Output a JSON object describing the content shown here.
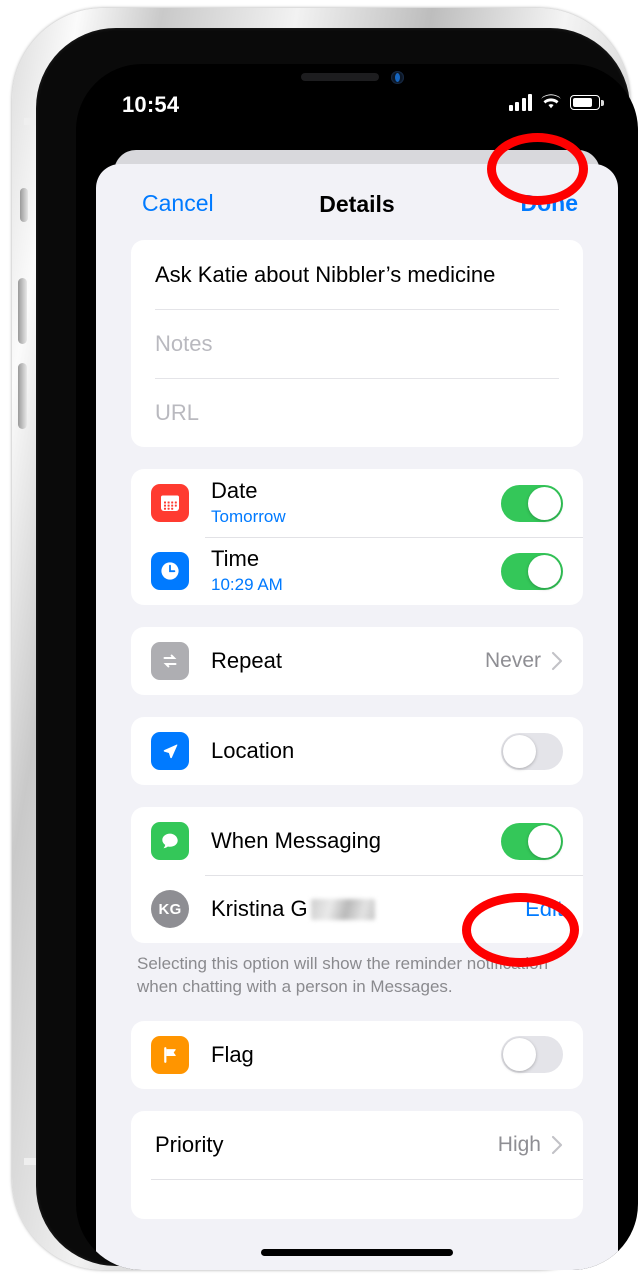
{
  "status_bar": {
    "time": "10:54",
    "signal_icon": "cellular-bars-icon",
    "wifi_icon": "wifi-icon",
    "battery_icon": "battery-icon"
  },
  "nav": {
    "cancel_label": "Cancel",
    "title": "Details",
    "done_label": "Done"
  },
  "fields": {
    "title_value": "Ask Katie about Nibbler’s medicine",
    "notes_placeholder": "Notes",
    "url_placeholder": "URL"
  },
  "rows": {
    "date": {
      "label": "Date",
      "sub": "Tomorrow",
      "icon": "calendar-icon",
      "icon_color": "#FF3B30",
      "toggle": "on"
    },
    "time": {
      "label": "Time",
      "sub": "10:29 AM",
      "icon": "clock-icon",
      "icon_color": "#007AFF",
      "toggle": "on"
    },
    "repeat": {
      "label": "Repeat",
      "value": "Never",
      "icon": "repeat-icon",
      "icon_color": "#AEAEB2",
      "accessory": "chevron-right-icon"
    },
    "location": {
      "label": "Location",
      "icon": "location-arrow-icon",
      "icon_color": "#007AFF",
      "toggle": "off"
    },
    "messaging": {
      "label": "When Messaging",
      "icon": "message-bubble-icon",
      "icon_color": "#34C759",
      "toggle": "on"
    },
    "contact": {
      "avatar_initials": "KG",
      "name": "Kristina G",
      "edit_label": "Edit"
    },
    "flag": {
      "label": "Flag",
      "icon": "flag-icon",
      "icon_color": "#FF9500",
      "toggle": "off"
    },
    "priority": {
      "label": "Priority",
      "value": "High",
      "accessory": "chevron-right-icon"
    }
  },
  "footnote": "Selecting this option will show the reminder notification when chatting with a person in Messages.",
  "annotations": [
    {
      "name": "done-highlight",
      "target": "Done",
      "color": "#FE0000",
      "shape": "ellipse"
    },
    {
      "name": "edit-highlight",
      "target": "Edit",
      "color": "#FE0000",
      "shape": "ellipse"
    }
  ],
  "colors": {
    "accent_blue": "#007AFF",
    "toggle_green": "#34C759",
    "background": "#F2F2F7",
    "annotation_red": "#FE0000"
  }
}
